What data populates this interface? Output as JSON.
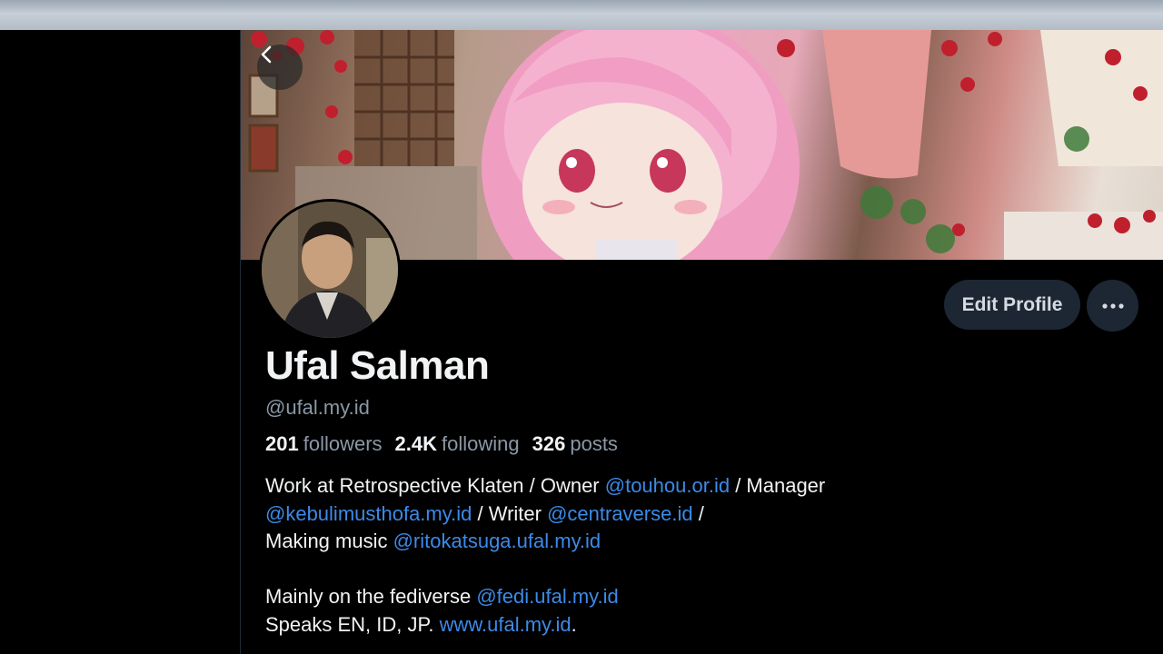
{
  "profile": {
    "display_name": "Ufal Salman",
    "handle": "@ufal.my.id",
    "edit_label": "Edit Profile",
    "more_label": "•••"
  },
  "stats": {
    "followers_count": "201",
    "followers_label": "followers",
    "following_count": "2.4K",
    "following_label": "following",
    "posts_count": "326",
    "posts_label": "posts"
  },
  "bio": {
    "l1a": "Work at Retrospective Klaten / Owner ",
    "l1b": "@touhou.or.id",
    "l1c": " / Manager",
    "l2a": "@kebulimusthofa.my.id",
    "l2b": " / Writer ",
    "l2c": "@centraverse.id",
    "l2d": " /",
    "l3a": "Making music ",
    "l3b": "@ritokatsuga.ufal.my.id",
    "l4a": "Mainly on the fediverse ",
    "l4b": "@fedi.ufal.my.id",
    "l5a": "Speaks EN, ID, JP. ",
    "l5b": "www.ufal.my.id",
    "l5c": "."
  },
  "icons": {
    "back": "chevron-left-icon",
    "more": "ellipsis-icon"
  },
  "colors": {
    "background": "#000000",
    "link": "#3c8ae8",
    "muted": "#8b98a5",
    "button": "#1d2733"
  }
}
